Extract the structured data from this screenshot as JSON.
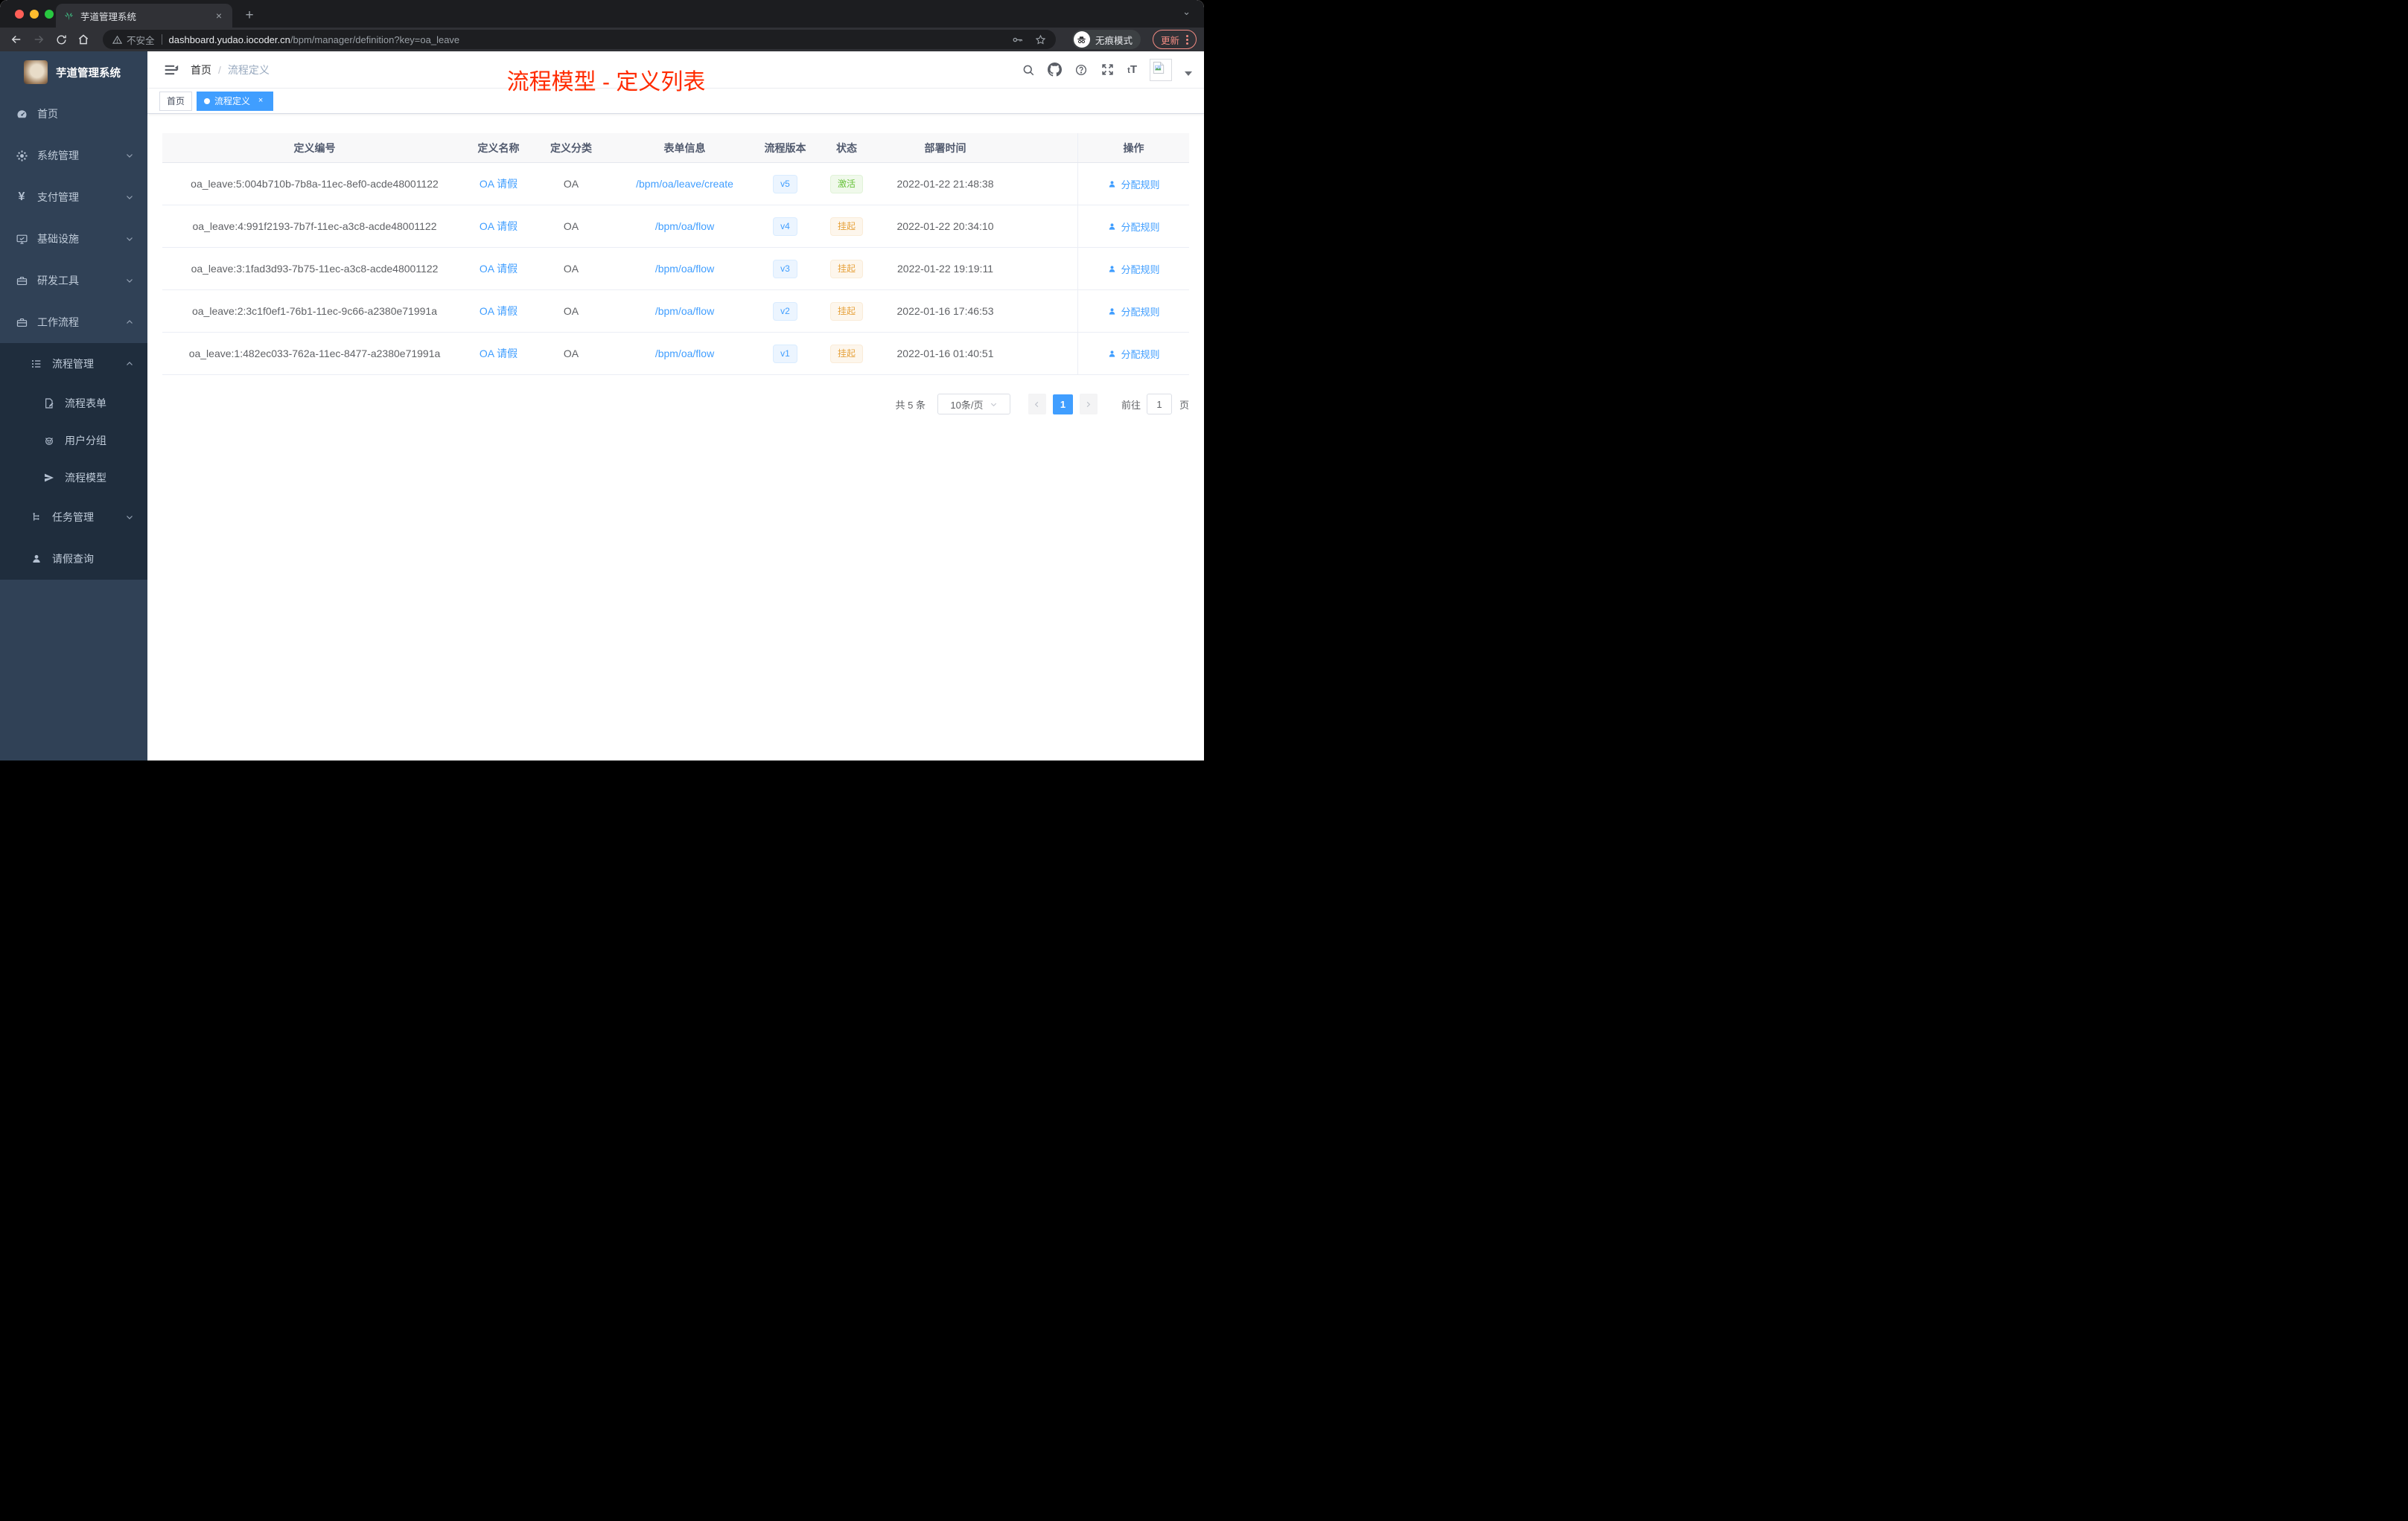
{
  "browser": {
    "tab_title": "芋道管理系统",
    "security_label": "不安全",
    "url_host": "dashboard.yudao.iocoder.cn",
    "url_path": "/bpm/manager/definition?key=oa_leave",
    "incognito_label": "无痕模式",
    "update_label": "更新"
  },
  "glyphs": {
    "tab_close": "×",
    "new_tab": "+",
    "window_caret": "⌄",
    "yen": "¥",
    "tag_close": "×"
  },
  "sidebar": {
    "brand": "芋道管理系统",
    "items": [
      {
        "label": "首页"
      },
      {
        "label": "系统管理"
      },
      {
        "label": "支付管理"
      },
      {
        "label": "基础设施"
      },
      {
        "label": "研发工具"
      },
      {
        "label": "工作流程"
      },
      {
        "label": "流程管理"
      },
      {
        "label": "流程表单"
      },
      {
        "label": "用户分组"
      },
      {
        "label": "流程模型"
      },
      {
        "label": "任务管理"
      },
      {
        "label": "请假查询"
      }
    ]
  },
  "header": {
    "breadcrumb_home": "首页",
    "breadcrumb_sep": "/",
    "breadcrumb_current": "流程定义",
    "annotation": "流程模型 - 定义列表"
  },
  "tags": [
    {
      "label": "首页"
    },
    {
      "label": "流程定义"
    }
  ],
  "table": {
    "columns": [
      "定义编号",
      "定义名称",
      "定义分类",
      "表单信息",
      "流程版本",
      "状态",
      "部署时间",
      "操作"
    ],
    "rows": [
      {
        "id": "oa_leave:5:004b710b-7b8a-11ec-8ef0-acde48001122",
        "name": "OA 请假",
        "category": "OA",
        "form": "/bpm/oa/leave/create",
        "version": "v5",
        "status": "激活",
        "time": "2022-01-22 21:48:38",
        "action": "分配规则"
      },
      {
        "id": "oa_leave:4:991f2193-7b7f-11ec-a3c8-acde48001122",
        "name": "OA 请假",
        "category": "OA",
        "form": "/bpm/oa/flow",
        "version": "v4",
        "status": "挂起",
        "time": "2022-01-22 20:34:10",
        "action": "分配规则"
      },
      {
        "id": "oa_leave:3:1fad3d93-7b75-11ec-a3c8-acde48001122",
        "name": "OA 请假",
        "category": "OA",
        "form": "/bpm/oa/flow",
        "version": "v3",
        "status": "挂起",
        "time": "2022-01-22 19:19:11",
        "action": "分配规则"
      },
      {
        "id": "oa_leave:2:3c1f0ef1-76b1-11ec-9c66-a2380e71991a",
        "name": "OA 请假",
        "category": "OA",
        "form": "/bpm/oa/flow",
        "version": "v2",
        "status": "挂起",
        "time": "2022-01-16 17:46:53",
        "action": "分配规则"
      },
      {
        "id": "oa_leave:1:482ec033-762a-11ec-8477-a2380e71991a",
        "name": "OA 请假",
        "category": "OA",
        "form": "/bpm/oa/flow",
        "version": "v1",
        "status": "挂起",
        "time": "2022-01-16 01:40:51",
        "action": "分配规则"
      }
    ]
  },
  "pagination": {
    "total": "共 5 条",
    "page_size": "10条/页",
    "current_page": "1",
    "goto_label": "前往",
    "goto_value": "1",
    "goto_unit": "页"
  },
  "colors": {
    "accent": "#409EFF",
    "annotation_red": "#FF2B00",
    "success": "#67C23A",
    "warning": "#E6A23C",
    "sidebar_bg": "#304156",
    "submenu_bg": "#1F2D3D"
  }
}
